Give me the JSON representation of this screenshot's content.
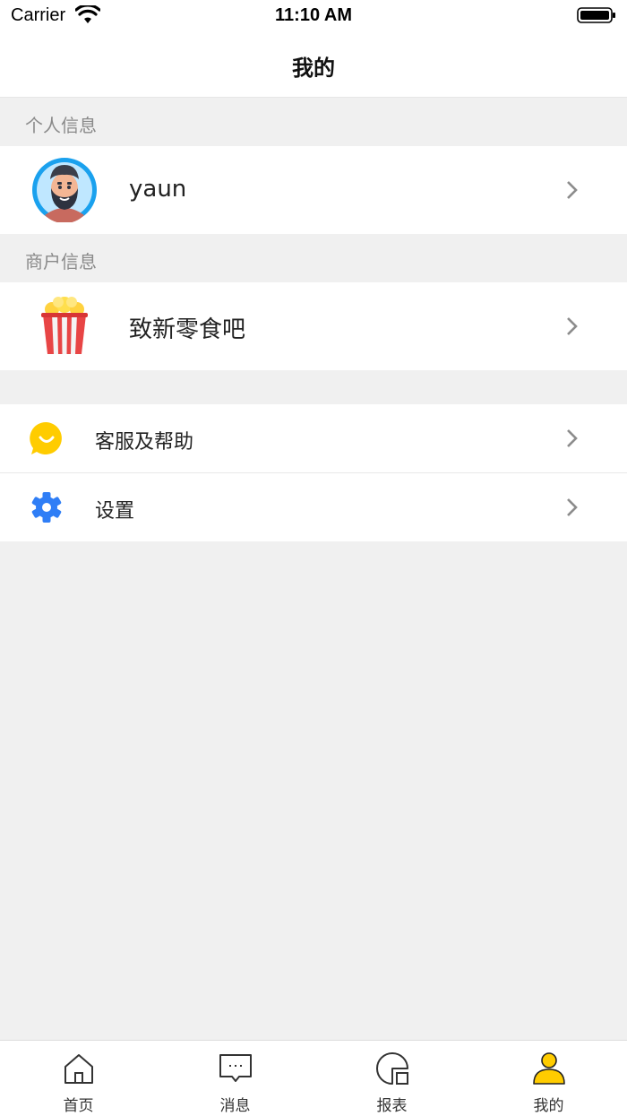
{
  "status_bar": {
    "carrier": "Carrier",
    "time": "11:10 AM"
  },
  "nav": {
    "title": "我的"
  },
  "sections": {
    "personal_header": "个人信息",
    "merchant_header": "商户信息"
  },
  "profile": {
    "name": "yaun",
    "avatar_icon": "bearded-man-avatar-icon"
  },
  "merchant": {
    "name": "致新零食吧",
    "logo_icon": "popcorn-icon"
  },
  "menu": [
    {
      "label": "客服及帮助",
      "icon": "smile-chat-icon",
      "color": "#ffcc00"
    },
    {
      "label": "设置",
      "icon": "gear-icon",
      "color": "#2f7ef6"
    }
  ],
  "tabs": [
    {
      "label": "首页",
      "icon": "home-icon"
    },
    {
      "label": "消息",
      "icon": "message-icon"
    },
    {
      "label": "报表",
      "icon": "report-icon"
    },
    {
      "label": "我的",
      "icon": "person-icon",
      "active": true
    }
  ],
  "colors": {
    "accent": "#ffcc00",
    "settings_blue": "#2f7ef6",
    "background": "#f0f0f0"
  }
}
